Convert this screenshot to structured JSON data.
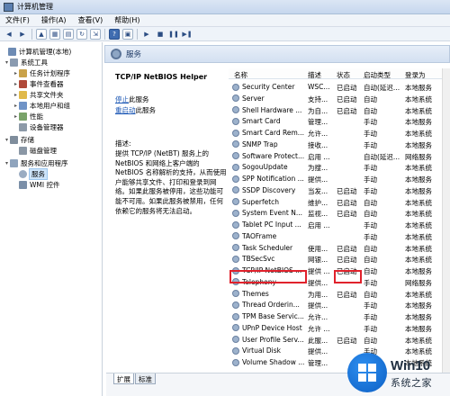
{
  "window": {
    "title": "计算机管理"
  },
  "menu": [
    "文件(F)",
    "操作(A)",
    "查看(V)",
    "帮助(H)"
  ],
  "tree": [
    {
      "label": "计算机管理(本地)",
      "level": 0,
      "exp": ""
    },
    {
      "label": "系统工具",
      "level": 1,
      "exp": "▾"
    },
    {
      "label": "任务计划程序",
      "level": 2,
      "exp": "▸"
    },
    {
      "label": "事件查看器",
      "level": 2,
      "exp": "▸"
    },
    {
      "label": "共享文件夹",
      "level": 2,
      "exp": "▸"
    },
    {
      "label": "本地用户和组",
      "level": 2,
      "exp": "▸"
    },
    {
      "label": "性能",
      "level": 2,
      "exp": "▸"
    },
    {
      "label": "设备管理器",
      "level": 2,
      "exp": ""
    },
    {
      "label": "存储",
      "level": 1,
      "exp": "▾"
    },
    {
      "label": "磁盘管理",
      "level": 2,
      "exp": ""
    },
    {
      "label": "服务和应用程序",
      "level": 1,
      "exp": "▾"
    },
    {
      "label": "服务",
      "level": 2,
      "exp": ""
    },
    {
      "label": "WMI 控件",
      "level": 2,
      "exp": ""
    }
  ],
  "services_header": "服务",
  "description_pane": {
    "service_name": "TCP/IP NetBIOS Helper",
    "stop_link": "停止",
    "stop_suffix": "此服务",
    "restart_link": "重启动",
    "restart_suffix": "此服务",
    "desc_label": "描述:",
    "desc_text": "提供 TCP/IP (NetBT) 服务上的 NetBIOS 和网络上客户端的 NetBIOS 名称解析的支持，从而使用户能够共享文件、打印和登录到网络。如果此服务被停用，这些功能可能不可用。如果此服务被禁用，任何依赖它的服务将无法启动。"
  },
  "columns": {
    "name": "名称",
    "desc": "描述",
    "status": "状态",
    "startup": "启动类型",
    "logon": "登录为"
  },
  "rows": [
    {
      "name": "Security Center",
      "desc": "WSC...",
      "status": "已启动",
      "startup": "自动(延迟...",
      "logon": "本地服务"
    },
    {
      "name": "Server",
      "desc": "支持...",
      "status": "已启动",
      "startup": "自动",
      "logon": "本地系统"
    },
    {
      "name": "Shell Hardware ...",
      "desc": "为自...",
      "status": "已启动",
      "startup": "自动",
      "logon": "本地系统"
    },
    {
      "name": "Smart Card",
      "desc": "管理...",
      "status": "",
      "startup": "手动",
      "logon": "本地服务"
    },
    {
      "name": "Smart Card Rem...",
      "desc": "允许...",
      "status": "",
      "startup": "手动",
      "logon": "本地系统"
    },
    {
      "name": "SNMP Trap",
      "desc": "接收...",
      "status": "",
      "startup": "手动",
      "logon": "本地服务"
    },
    {
      "name": "Software Protect...",
      "desc": "启用 ...",
      "status": "",
      "startup": "自动(延迟...",
      "logon": "网络服务"
    },
    {
      "name": "SogouUpdate",
      "desc": "为搜...",
      "status": "",
      "startup": "手动",
      "logon": "本地系统"
    },
    {
      "name": "SPP Notification ...",
      "desc": "提供...",
      "status": "",
      "startup": "手动",
      "logon": "本地服务"
    },
    {
      "name": "SSDP Discovery",
      "desc": "当发...",
      "status": "已启动",
      "startup": "手动",
      "logon": "本地服务"
    },
    {
      "name": "Superfetch",
      "desc": "维护...",
      "status": "已启动",
      "startup": "自动",
      "logon": "本地系统"
    },
    {
      "name": "System Event N...",
      "desc": "监视...",
      "status": "已启动",
      "startup": "自动",
      "logon": "本地系统"
    },
    {
      "name": "Tablet PC Input ...",
      "desc": "启用 ...",
      "status": "",
      "startup": "手动",
      "logon": "本地系统"
    },
    {
      "name": "TAOFrame",
      "desc": "",
      "status": "",
      "startup": "手动",
      "logon": "本地系统"
    },
    {
      "name": "Task Scheduler",
      "desc": "使用...",
      "status": "已启动",
      "startup": "自动",
      "logon": "本地系统"
    },
    {
      "name": "TBSecSvc",
      "desc": "网银...",
      "status": "已启动",
      "startup": "自动",
      "logon": "本地系统"
    },
    {
      "name": "TCP/IP NetBIOS ...",
      "desc": "提供 ...",
      "status": "已启动",
      "startup": "自动",
      "logon": "本地服务"
    },
    {
      "name": "Telephony",
      "desc": "提供...",
      "status": "",
      "startup": "手动",
      "logon": "网络服务"
    },
    {
      "name": "Themes",
      "desc": "为用...",
      "status": "已启动",
      "startup": "自动",
      "logon": "本地系统"
    },
    {
      "name": "Thread Orderin...",
      "desc": "提供...",
      "status": "",
      "startup": "手动",
      "logon": "本地服务"
    },
    {
      "name": "TPM Base Servic...",
      "desc": "允许...",
      "status": "",
      "startup": "手动",
      "logon": "本地服务"
    },
    {
      "name": "UPnP Device Host",
      "desc": "允许 ...",
      "status": "",
      "startup": "手动",
      "logon": "本地服务"
    },
    {
      "name": "User Profile Serv...",
      "desc": "此服...",
      "status": "已启动",
      "startup": "自动",
      "logon": "本地系统"
    },
    {
      "name": "Virtual Disk",
      "desc": "提供...",
      "status": "",
      "startup": "手动",
      "logon": "本地系统"
    },
    {
      "name": "Volume Shadow ...",
      "desc": "管理...",
      "status": "",
      "startup": "手动",
      "logon": "本地系统"
    }
  ],
  "tabs": [
    "扩展",
    "标准"
  ],
  "logo": {
    "brand": "Win10",
    "subtitle": "系统之家"
  },
  "colors": {
    "highlight": "#e0222c",
    "link": "#1a56b4",
    "logo_blue": "#0c5fc4"
  }
}
